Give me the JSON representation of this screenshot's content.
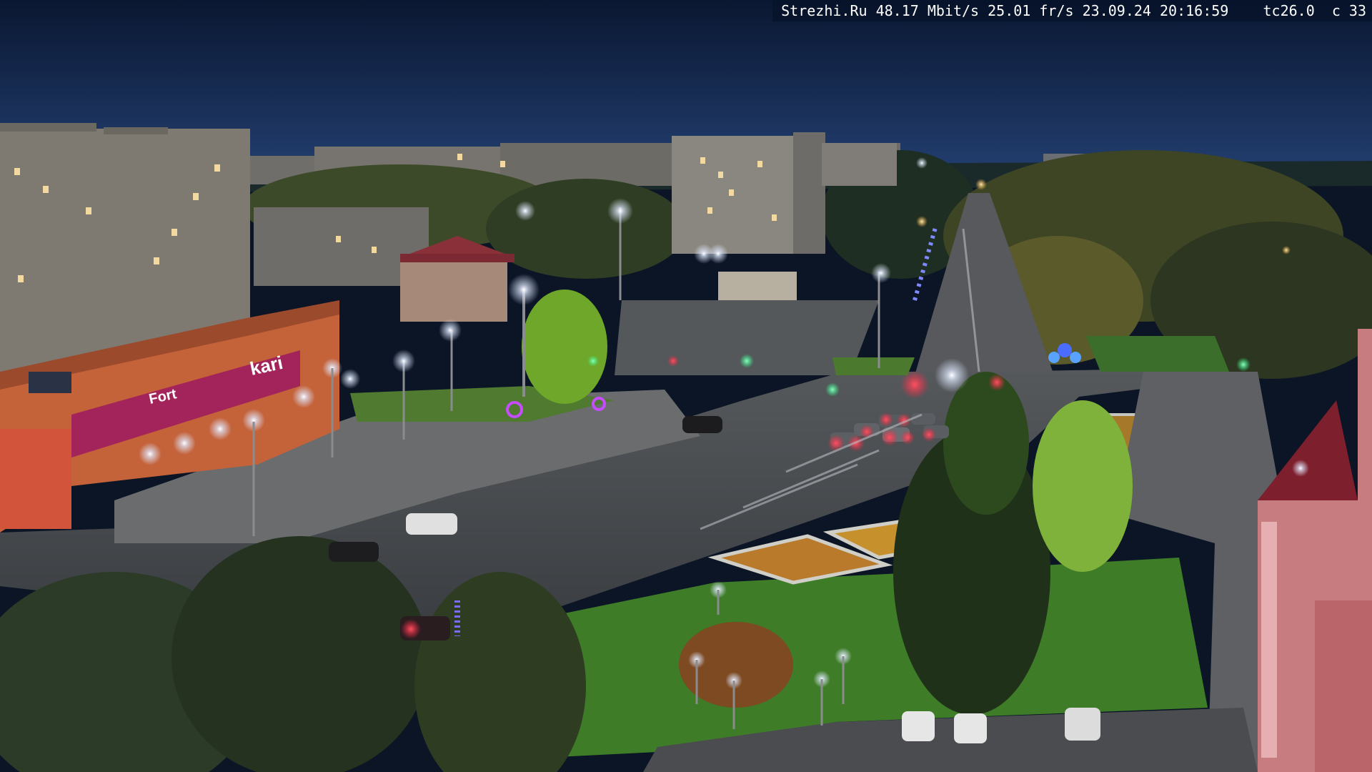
{
  "overlay": {
    "site": "Strezhi.Ru",
    "bitrate": "48.17 Mbit/s",
    "framerate": "25.01 fr/s",
    "date": "23.09.24",
    "time": "20:16:59",
    "temp": "tc26.0",
    "cam": "c 33"
  },
  "signs": {
    "store_main": "kari",
    "store_side": "Fort"
  },
  "colors": {
    "sky_top": "#0c1a35",
    "sky_bottom": "#1d3561",
    "road": "#3f4347",
    "grass": "#3f7a2a",
    "store_wall": "#c4623a",
    "sign_magenta": "#a3245a",
    "lamp": "#f4f8ff",
    "brake_light": "#ff2b45",
    "signal_green": "#35ff8a"
  }
}
